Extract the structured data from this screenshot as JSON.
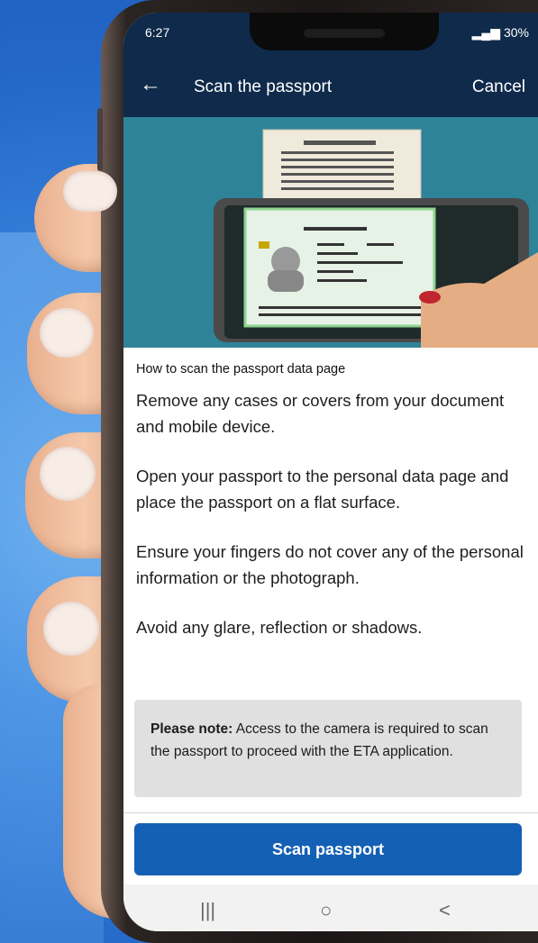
{
  "statusbar": {
    "time": "6:27",
    "battery": "30%"
  },
  "appbar": {
    "back_icon": "arrow-left-icon",
    "title": "Scan the passport",
    "cancel_label": "Cancel"
  },
  "instructions": {
    "heading": "How to scan the passport data page",
    "steps": [
      "Remove any cases or covers from your document and mobile device.",
      "Open your passport to the personal data page and place the passport on a flat surface.",
      "Ensure your fingers do not cover any of the personal information or the photograph.",
      "Avoid any glare, reflection or shadows."
    ]
  },
  "note": {
    "label": "Please note:",
    "text": " Access to the camera is required to scan the passport to proceed with the ETA application."
  },
  "primary_button": {
    "label": "Scan passport"
  },
  "navbar": {
    "recents_glyph": "|||",
    "home_glyph": "○",
    "back_glyph": "<"
  },
  "colors": {
    "header": "#0f2a4a",
    "hero_bg": "#2e8399",
    "button": "#1460b4",
    "note_bg": "#e0e0e0"
  }
}
